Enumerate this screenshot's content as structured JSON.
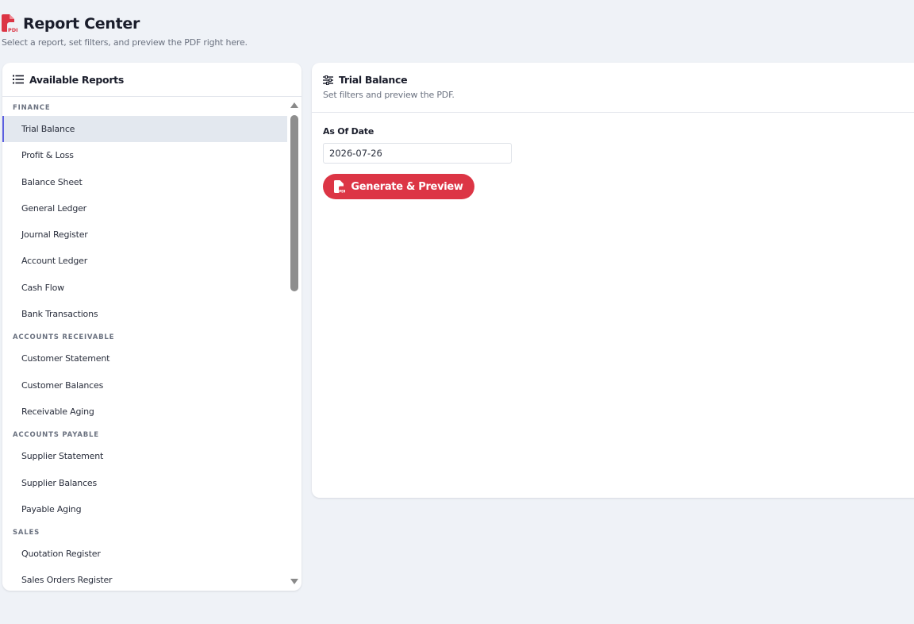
{
  "header": {
    "title": "Report Center",
    "subtitle": "Select a report, set filters, and preview the PDF right here.",
    "icon": "pdf-file-icon"
  },
  "sidebar": {
    "title": "Available Reports",
    "icon": "list-icon",
    "groups": [
      {
        "label": "FINANCE",
        "items": [
          "Trial Balance",
          "Profit & Loss",
          "Balance Sheet",
          "General Ledger",
          "Journal Register",
          "Account Ledger",
          "Cash Flow",
          "Bank Transactions"
        ]
      },
      {
        "label": "ACCOUNTS RECEIVABLE",
        "items": [
          "Customer Statement",
          "Customer Balances",
          "Receivable Aging"
        ]
      },
      {
        "label": "ACCOUNTS PAYABLE",
        "items": [
          "Supplier Statement",
          "Supplier Balances",
          "Payable Aging"
        ]
      },
      {
        "label": "SALES",
        "items": [
          "Quotation Register",
          "Sales Orders Register"
        ]
      }
    ],
    "selected": "Trial Balance"
  },
  "panel": {
    "title": "Trial Balance",
    "subtitle": "Set filters and preview the PDF.",
    "icon": "sliders-icon",
    "field_label": "As Of Date",
    "field_value": "2026-07-26",
    "button_label": "Generate & Preview"
  },
  "colors": {
    "accent": "#dc3545",
    "selected_bg": "#e3e8ef",
    "selected_border": "#5b5fe0",
    "page_bg": "#eff2f7"
  }
}
